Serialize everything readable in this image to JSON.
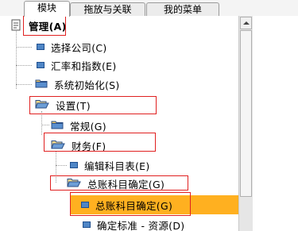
{
  "tabs": [
    {
      "label": "模块",
      "active": true
    },
    {
      "label": "拖放与关联",
      "active": false
    },
    {
      "label": "我的菜单",
      "active": false
    }
  ],
  "tree": [
    {
      "label": "管理(A)",
      "icon": "root-module-icon",
      "bold": true
    },
    {
      "label": "选择公司(C)",
      "icon": "blue-square-icon"
    },
    {
      "label": "汇率和指数(E)",
      "icon": "blue-square-icon"
    },
    {
      "label": "系统初始化(S)",
      "icon": "folder-icon"
    },
    {
      "label": "设置(T)",
      "icon": "folder-open-icon"
    },
    {
      "label": "常规(G)",
      "icon": "folder-icon"
    },
    {
      "label": "财务(F)",
      "icon": "folder-open-icon"
    },
    {
      "label": "编辑科目表(E)",
      "icon": "blue-square-icon"
    },
    {
      "label": "总账科目确定(G)",
      "icon": "folder-open-icon"
    },
    {
      "label": "总账科目确定(G)",
      "icon": "blue-square-icon",
      "selected": true
    },
    {
      "label": "确定标准 - 资源(D)",
      "icon": "blue-square-icon"
    }
  ],
  "colors": {
    "selection": "#ffb020",
    "highlight_box": "#e02020",
    "folder": "#f0c868",
    "item": "#4f86c6"
  }
}
